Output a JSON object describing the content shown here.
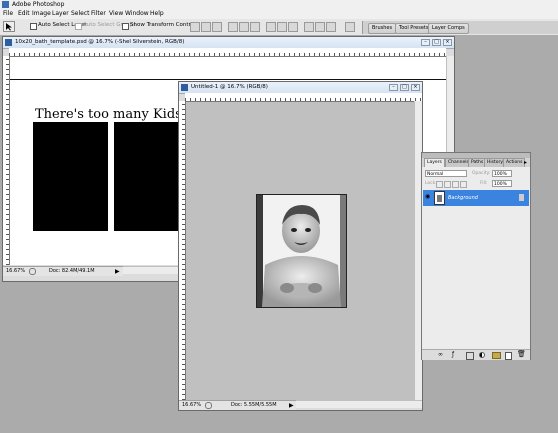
{
  "app": {
    "title": "Adobe Photoshop"
  },
  "menu": [
    "File",
    "Edit",
    "Image",
    "Layer",
    "Select",
    "Filter",
    "View",
    "Window",
    "Help"
  ],
  "options_bar": {
    "auto_select_layer": "Auto Select Layer",
    "auto_select_groups": "Auto Select Groups",
    "show_transform_controls": "Show Transform Controls",
    "well_tabs": [
      "Brushes",
      "Tool Presets",
      "Layer Comps"
    ]
  },
  "doc1": {
    "title": "10x20_bath_template.psd @ 16.7% (-Shel Silverstein, RGB/8)",
    "canvas_text": "There's too many Kids i",
    "zoom": "16.67%",
    "doc_size": "Doc: 82.4M/49.1M"
  },
  "doc2": {
    "title": "Untitled-1 @ 16.7% (RGB/8)",
    "zoom": "16.67%",
    "doc_size": "Doc: 5.55M/5.55M"
  },
  "layers_panel": {
    "tabs": [
      "Layers",
      "Channels",
      "Paths",
      "History",
      "Actions"
    ],
    "blend_mode": "Normal",
    "opacity_label": "Opacity:",
    "opacity_value": "100%",
    "lock_label": "Lock:",
    "fill_label": "Fill:",
    "fill_value": "100%",
    "layer_name": "Background"
  },
  "colors": {
    "workspace": "#ababab",
    "selected_layer": "#3a84e0",
    "doc_title_bar": "#dbe6f3"
  }
}
